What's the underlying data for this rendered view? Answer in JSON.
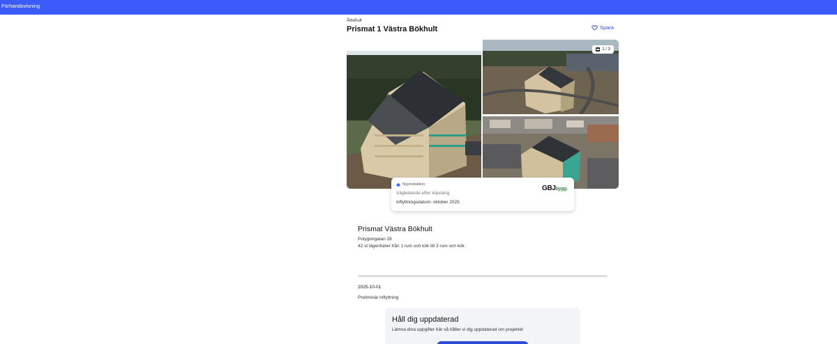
{
  "header": {
    "title": "Förhandsvisning",
    "bg_color": "#3b5bfb"
  },
  "breadcrumb": "Ålbohult",
  "listing_title": "Prismat 1 Västra Bökhult",
  "save_label": "Spara",
  "gallery": {
    "counter": "1 / 3",
    "images": [
      "building-main",
      "building-aerial-1",
      "building-aerial-2"
    ]
  },
  "card": {
    "badge": "Nyproduktion",
    "line1": "Vägledande efter köpoäng",
    "line2": "Inflyttningsdatum: oktober 2025",
    "logo_main": "GBJ",
    "logo_sub": "bygg."
  },
  "project": {
    "title": "Prismat Västra Bökhult",
    "address": "Polygongatan 28",
    "description": "42 st lägenheter från 1 rum och kök till 3 rum och kök"
  },
  "timeline": {
    "progress": 0,
    "date": "2025-10-01",
    "status": "Preliminär inflyttning"
  },
  "newsletter": {
    "heading": "Håll dig uppdaterad",
    "text": "Lämna dina uppgifter här så håller vi dig uppdaterad om projektet"
  },
  "colors": {
    "accent": "#2d4bd6",
    "logo_green": "#2e8f3d"
  }
}
